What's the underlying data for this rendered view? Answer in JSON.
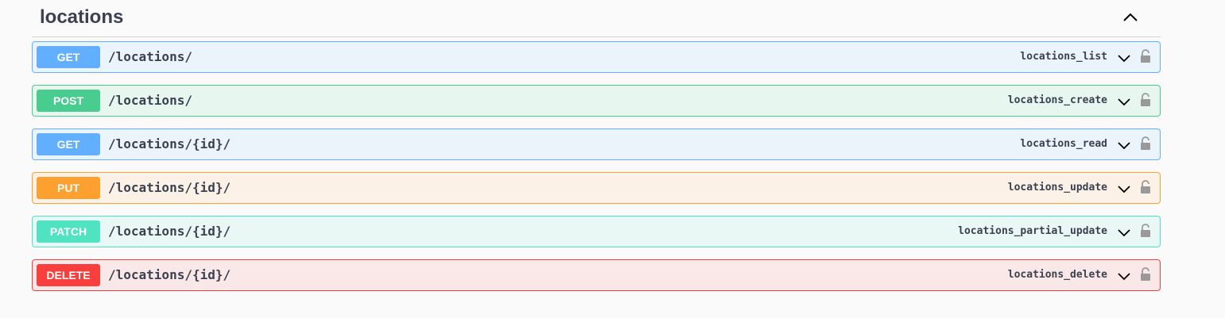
{
  "tag": {
    "title": "locations"
  },
  "operations": [
    {
      "method": "GET",
      "path": "/locations/",
      "operation_id": "locations_list",
      "color": "#61affe",
      "bg": "#ebf3fb"
    },
    {
      "method": "POST",
      "path": "/locations/",
      "operation_id": "locations_create",
      "color": "#49cc90",
      "bg": "#e8f6f0"
    },
    {
      "method": "GET",
      "path": "/locations/{id}/",
      "operation_id": "locations_read",
      "color": "#61affe",
      "bg": "#ebf3fb"
    },
    {
      "method": "PUT",
      "path": "/locations/{id}/",
      "operation_id": "locations_update",
      "color": "#fca130",
      "bg": "#fbf1e6"
    },
    {
      "method": "PATCH",
      "path": "/locations/{id}/",
      "operation_id": "locations_partial_update",
      "color": "#50e3c2",
      "bg": "#e9f8f5"
    },
    {
      "method": "DELETE",
      "path": "/locations/{id}/",
      "operation_id": "locations_delete",
      "color": "#f93e3e",
      "bg": "#fae7e7"
    }
  ],
  "icons": {
    "collapse": "chevron-up-icon",
    "expand": "chevron-down-icon",
    "auth": "lock-icon"
  }
}
